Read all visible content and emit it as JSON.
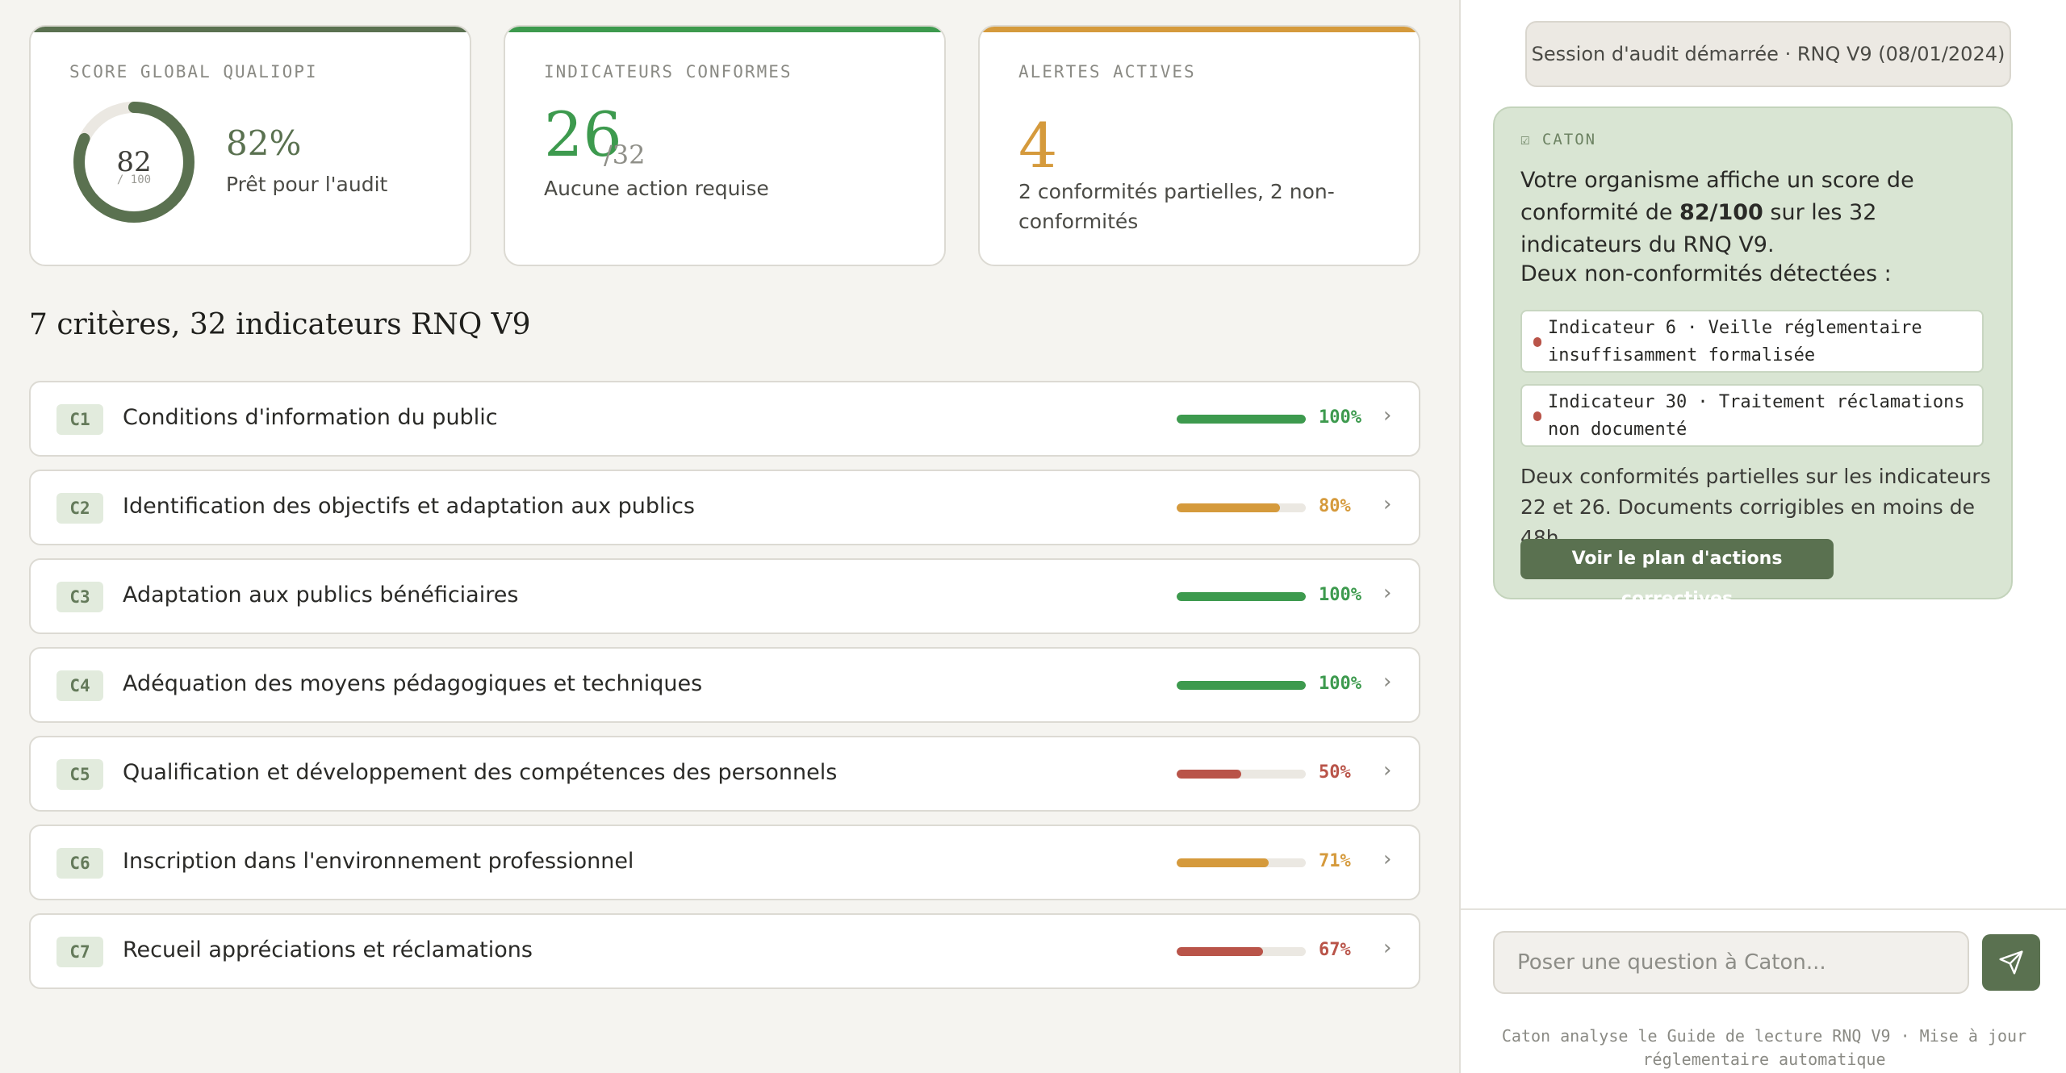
{
  "cards": {
    "score": {
      "label": "SCORE GLOBAL QUALIOPI",
      "ring_value": "82",
      "ring_sub": "/ 100",
      "percent": "82%",
      "fraction": 0.82,
      "description": "Prêt pour l'audit",
      "color": "#5a7150"
    },
    "indicators": {
      "label": "INDICATEURS CONFORMES",
      "value": "26",
      "total": "/32",
      "description": "Aucune action requise",
      "color": "#3d9a4e"
    },
    "alerts": {
      "label": "ALERTES ACTIVES",
      "value": "4",
      "description": "2 conformités partielles, 2 non-conformités",
      "color": "#d59a3c"
    }
  },
  "section_title": "7 critères, 32 indicateurs RNQ V9",
  "criteria": [
    {
      "code": "C1",
      "label": "Conditions d'information du public",
      "percent_text": "100%",
      "percent": 100,
      "color": "#3d9a4e"
    },
    {
      "code": "C2",
      "label": "Identification des objectifs et adaptation aux publics",
      "percent_text": "80%",
      "percent": 80,
      "color": "#d59a3c"
    },
    {
      "code": "C3",
      "label": "Adaptation aux publics bénéficiaires",
      "percent_text": "100%",
      "percent": 100,
      "color": "#3d9a4e"
    },
    {
      "code": "C4",
      "label": "Adéquation des moyens pédagogiques et techniques",
      "percent_text": "100%",
      "percent": 100,
      "color": "#3d9a4e"
    },
    {
      "code": "C5",
      "label": "Qualification et développement des compétences des personnels",
      "percent_text": "50%",
      "percent": 50,
      "color": "#b95449"
    },
    {
      "code": "C6",
      "label": "Inscription dans l'environnement professionnel",
      "percent_text": "71%",
      "percent": 71,
      "color": "#d59a3c"
    },
    {
      "code": "C7",
      "label": "Recueil appréciations et réclamations",
      "percent_text": "67%",
      "percent": 67,
      "color": "#b95449"
    }
  ],
  "chat": {
    "session": "Session d'audit démarrée · RNQ V9 (08/01/2024)",
    "assistant_tag": "☑ CATON",
    "message_prefix": "Votre organisme affiche un score de conformité de ",
    "message_score": "82/100",
    "message_suffix": " sur les 32 indicateurs du RNQ V9.",
    "nonconformities_title": "Deux non-conformités détectées :",
    "issues": [
      "Indicateur 6 · Veille réglementaire insuffisamment formalisée",
      "Indicateur 30 · Traitement réclamations non documenté"
    ],
    "partial_text": "Deux conformités partielles sur les indicateurs 22 et 26. Documents corrigibles en moins de 48h.",
    "action_button": "Voir le plan d'actions correctives",
    "input_placeholder": "Poser une question à Caton...",
    "send_icon": "send-icon",
    "footnote": "Caton analyse le Guide de lecture RNQ V9 · Mise à jour réglementaire automatique"
  }
}
